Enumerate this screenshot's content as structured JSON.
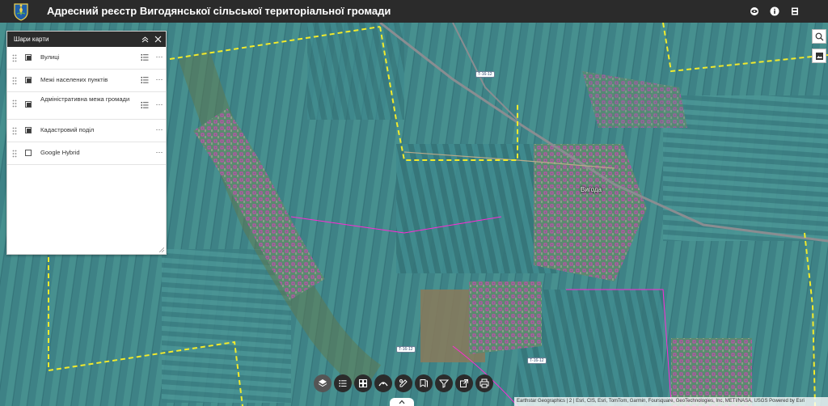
{
  "header": {
    "title": "Адресний реєстр Вигодянської сільської територіальної громади",
    "icons": [
      "coat-of-arms-logo",
      "eye-icon",
      "info-icon",
      "bookmark-icon"
    ]
  },
  "layers_panel": {
    "title": "Шари карти",
    "layers": [
      {
        "name": "Вулиці",
        "checked": true,
        "has_legend": true
      },
      {
        "name": "Межі населених пунктів",
        "checked": true,
        "has_legend": true
      },
      {
        "name": "Адміністративна межа громади",
        "checked": true,
        "has_legend": true
      },
      {
        "name": "Кадастровий поділ",
        "checked": true,
        "has_legend": false
      },
      {
        "name": "Google Hybrid",
        "checked": false,
        "has_legend": false
      }
    ],
    "more_label": "···"
  },
  "map": {
    "place_label": "Вигода",
    "road_shields": [
      "Т-16-12",
      "Т-16-12",
      "Т-16-12"
    ],
    "colors": {
      "fields": "#3f8488",
      "parcel_outline": "#ff2ad4",
      "boundary": "#f2ea2c",
      "road": "#8a8d91"
    }
  },
  "side_tools": [
    "search-icon",
    "basemap-icon"
  ],
  "bottom_toolbar": [
    "layers-icon",
    "legend-icon",
    "basemap-gallery-icon",
    "measure-icon",
    "sketch-icon",
    "bookmarks-icon",
    "filter-icon",
    "share-icon",
    "print-icon"
  ],
  "attribution": "Earthstar Geographics | 2 | Esri, CIS, Esri, TomTom, Garmin, Foursquare, GeoTechnologies, Inc, METI/NASA, USGS   Powered by Esri"
}
